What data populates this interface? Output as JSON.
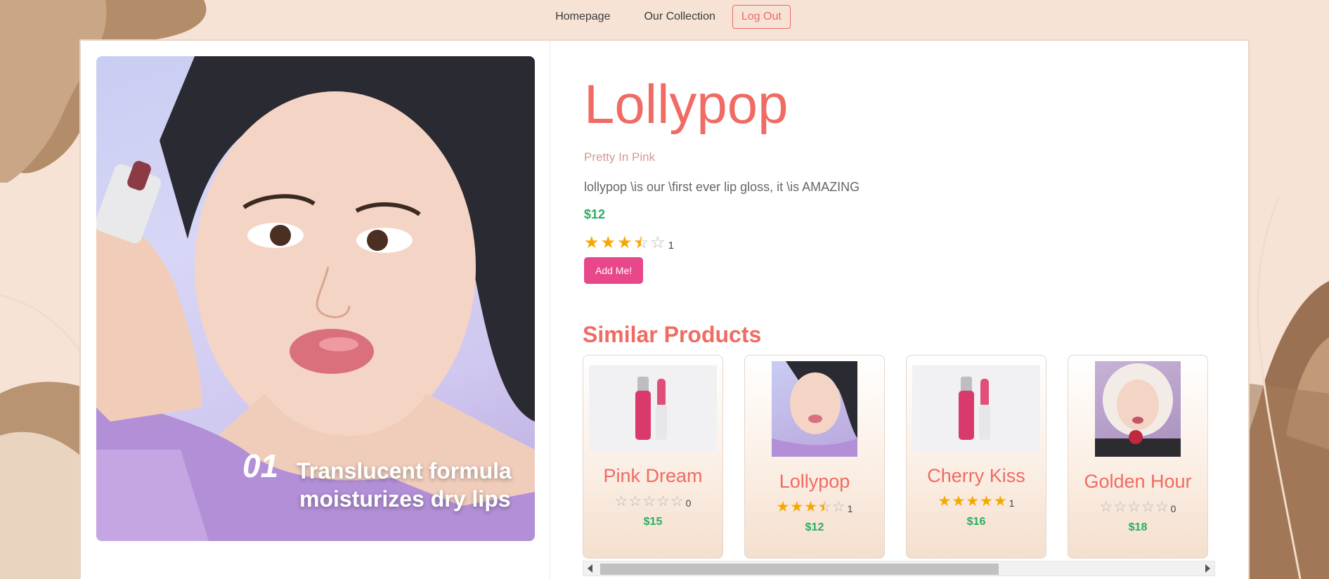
{
  "nav": {
    "home_label": "Homepage",
    "collection_label": "Our Collection",
    "logout_label": "Log Out"
  },
  "hero": {
    "caption_number": "01",
    "caption_line1": "Translucent formula",
    "caption_line2": "moisturizes dry lips"
  },
  "product": {
    "name": "Lollypop",
    "collection": "Pretty In Pink",
    "description": "lollypop \\is our \\first ever lip gloss, it \\is AMAZING",
    "price": "$12",
    "rating": 3.5,
    "rating_count": "1",
    "add_label": "Add Me!"
  },
  "similar": {
    "title": "Similar Products",
    "items": [
      {
        "name": "Pink Dream",
        "rating": 0,
        "rating_count": "0",
        "price": "$15",
        "image": "lip-gloss-tube"
      },
      {
        "name": "Lollypop",
        "rating": 3.5,
        "rating_count": "1",
        "price": "$12",
        "image": "model-portrait"
      },
      {
        "name": "Cherry Kiss",
        "rating": 5,
        "rating_count": "1",
        "price": "$16",
        "image": "lip-gloss-tube"
      },
      {
        "name": "Golden Hour",
        "rating": 0,
        "rating_count": "0",
        "price": "$18",
        "image": "model-portrait-hood"
      }
    ]
  },
  "colors": {
    "accent": "#ef6b63",
    "price_green": "#27ae60",
    "button_pink": "#e8488a",
    "star_gold": "#f5a800",
    "background": "#f6e3d6"
  }
}
